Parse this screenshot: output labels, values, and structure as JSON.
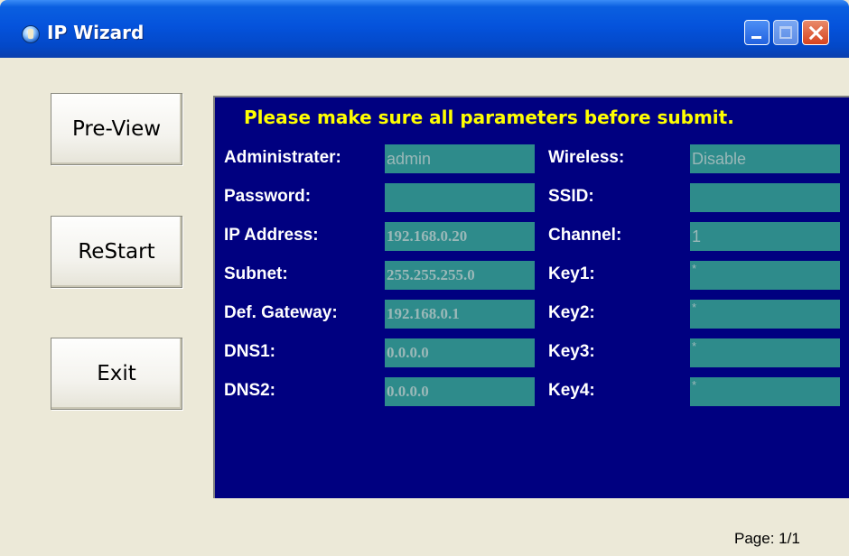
{
  "window": {
    "title": "IP Wizard"
  },
  "buttons": {
    "preview": "Pre-View",
    "restart": "ReStart",
    "exit": "Exit"
  },
  "panel": {
    "heading": "Please make sure all parameters before submit.",
    "left": [
      {
        "label": "Administrater:",
        "value": "admin"
      },
      {
        "label": "Password:",
        "value": ""
      },
      {
        "label": "IP Address:",
        "value": "192.168.0.20"
      },
      {
        "label": "Subnet:",
        "value": "255.255.255.0"
      },
      {
        "label": "Def. Gateway:",
        "value": "192.168.0.1"
      },
      {
        "label": "DNS1:",
        "value": "0.0.0.0"
      },
      {
        "label": "DNS2:",
        "value": "0.0.0.0"
      }
    ],
    "right": [
      {
        "label": "Wireless:",
        "value": "Disable"
      },
      {
        "label": "SSID:",
        "value": ""
      },
      {
        "label": "Channel:",
        "value": "1"
      },
      {
        "label": "Key1:",
        "value": "*"
      },
      {
        "label": "Key2:",
        "value": "*"
      },
      {
        "label": "Key3:",
        "value": "*"
      },
      {
        "label": "Key4:",
        "value": "*"
      }
    ]
  },
  "page_indicator": "Page: 1/1",
  "colors": {
    "panel_bg": "#000080",
    "heading": "#ffff00",
    "field_bg": "#2e8b8b",
    "window_bg": "#ece9d8"
  }
}
